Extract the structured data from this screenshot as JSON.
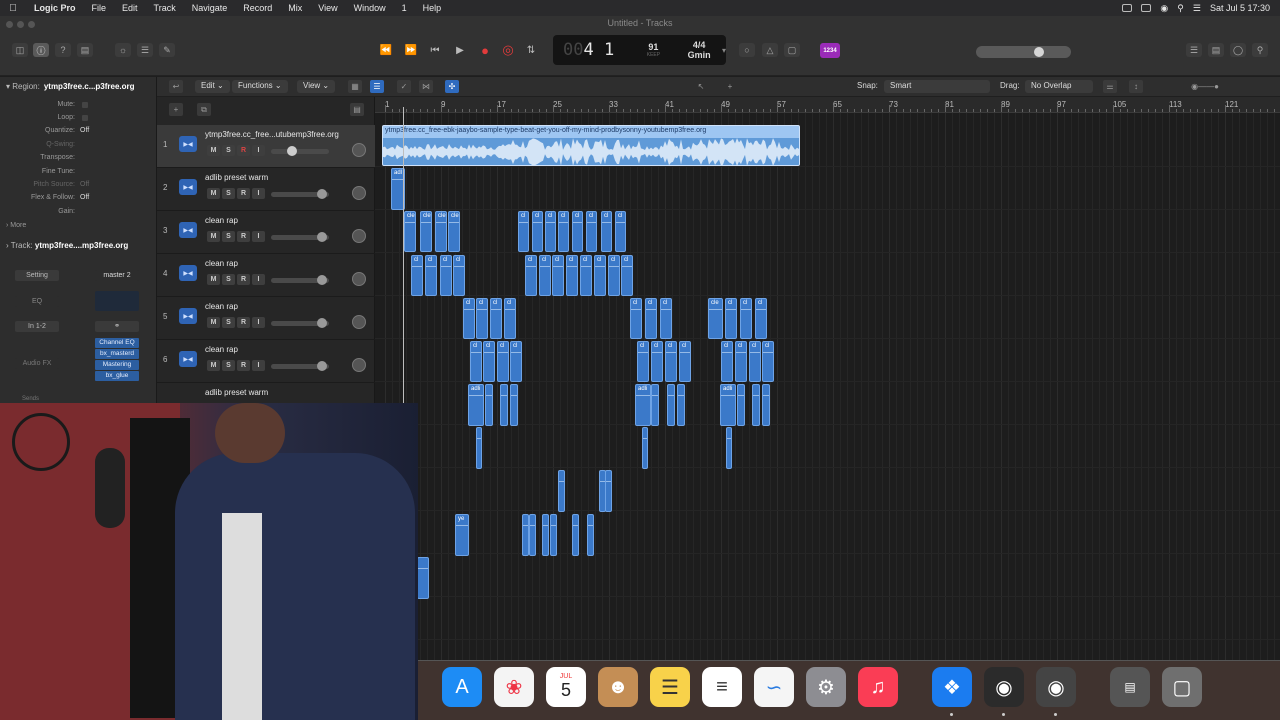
{
  "menubar": {
    "items": [
      "Logic Pro",
      "File",
      "Edit",
      "Track",
      "Navigate",
      "Record",
      "Mix",
      "View",
      "Window",
      "1",
      "Help"
    ],
    "clock": "Sat Jul 5  17:30"
  },
  "window": {
    "title": "Untitled - Tracks"
  },
  "lcd": {
    "bar_prefix": "00",
    "bar": "4",
    "beat": "1",
    "bar_label": "BAR",
    "beat_label": "BEAT",
    "tempo": "91",
    "tempo_mode": "KEEP",
    "tempo_label": "TEMPO",
    "time_signature": "4/4",
    "key": "Gmin"
  },
  "count_in": "1234",
  "inspector": {
    "region_label": "Region:",
    "region_name": "ytmp3free.c...p3free.org",
    "rows": [
      {
        "label": "Mute:",
        "value": "",
        "check": true
      },
      {
        "label": "Loop:",
        "value": "",
        "check": true
      },
      {
        "label": "Quantize:",
        "value": "Off"
      },
      {
        "label": "Q-Swing:",
        "value": "",
        "dim": true
      },
      {
        "label": "Transpose:",
        "value": ""
      },
      {
        "label": "Fine Tune:",
        "value": ""
      },
      {
        "label": "Pitch Source:",
        "value": "Off",
        "dim": true
      },
      {
        "label": "Flex & Follow:",
        "value": "Off"
      },
      {
        "label": "Gain:",
        "value": ""
      }
    ],
    "more_label": "More",
    "track_label": "Track:",
    "track_name": "ytmp3free....mp3free.org",
    "setting": "Setting",
    "master": "master 2",
    "eq": "EQ",
    "input": "In 1-2",
    "audio_fx": "Audio FX",
    "plugins": [
      "Channel EQ",
      "bx_masterd",
      "Mastering",
      "bx_glue"
    ],
    "sends": "Sends"
  },
  "localbar": {
    "edit": "Edit",
    "functions": "Functions",
    "view": "View",
    "snap_label": "Snap:",
    "snap_value": "Smart",
    "drag_label": "Drag:",
    "drag_value": "No Overlap"
  },
  "tracks": [
    {
      "num": "1",
      "name": "ytmp3free.cc_free...utubemp3free.org"
    },
    {
      "num": "2",
      "name": "adlib preset warm"
    },
    {
      "num": "3",
      "name": "clean rap"
    },
    {
      "num": "4",
      "name": "clean rap"
    },
    {
      "num": "5",
      "name": "clean rap"
    },
    {
      "num": "6",
      "name": "clean rap"
    },
    {
      "num": "",
      "name": "adlib preset warm"
    }
  ],
  "ruler": [
    "1",
    "9",
    "17",
    "25",
    "33",
    "41",
    "49",
    "57",
    "65",
    "73",
    "81",
    "89",
    "97",
    "105",
    "113",
    "121"
  ],
  "audio_region": {
    "name": "ytmp3free.cc_free-ebk-jaaybo-sample-type-beat-get-you-off-my-mind-prodbysonny-youtubemp3free.org"
  },
  "region_labels": {
    "adlib": "adl",
    "clean_short": "cle",
    "clean_tiny": "cl",
    "adli": "adli",
    "ye": "ye"
  },
  "dock": {
    "calendar_month": "JUL",
    "calendar_day": "5"
  },
  "colors": {
    "region_blue": "#3b79c9",
    "audio_region": "#9ec6f2",
    "record_red": "#e23b3b",
    "count_in_purple": "#9a2bb8"
  }
}
